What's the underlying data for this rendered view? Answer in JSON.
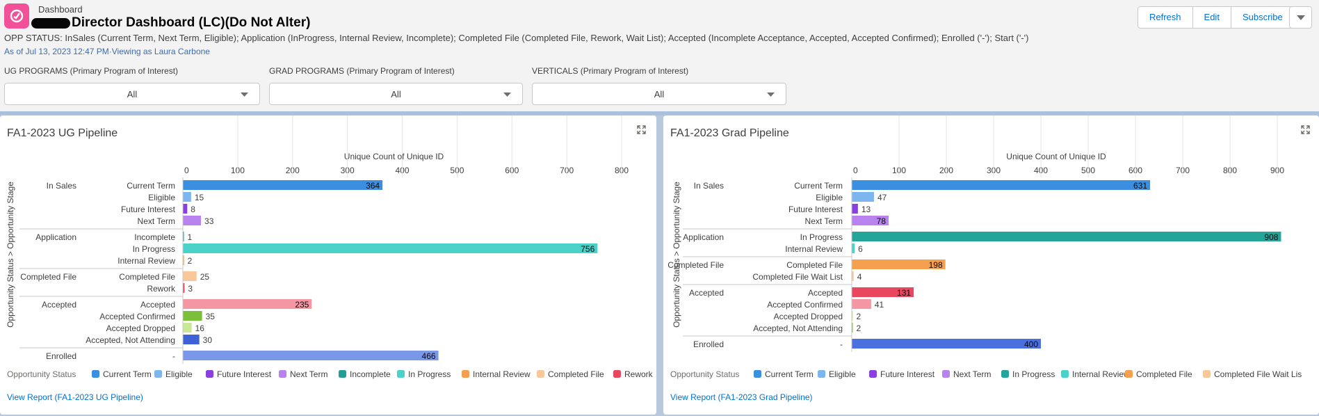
{
  "header": {
    "breadcrumb": "Dashboard",
    "title": "Director Dashboard (LC)(Do Not Alter)",
    "status_line": "OPP STATUS: InSales (Current Term, Next Term, Eligible); Application (InProgress, Internal Review, Incomplete); Completed File (Completed File, Rework, Wait List); Accepted (Incomplete Acceptance, Accepted, Accepted Confirmed); Enrolled ('-'); Start ('-')",
    "as_of": "As of Jul 13, 2023 12:47 PM·Viewing as Laura Carbone",
    "buttons": {
      "refresh": "Refresh",
      "edit": "Edit",
      "subscribe": "Subscribe"
    },
    "app_icon": "dashboard-app-icon",
    "menu_icon": "chevron-down-icon"
  },
  "filters": [
    {
      "label": "UG PROGRAMS (Primary Program of Interest)",
      "value": "All"
    },
    {
      "label": "GRAD PROGRAMS (Primary Program of Interest)",
      "value": "All"
    },
    {
      "label": "VERTICALS (Primary Program of Interest)",
      "value": "All"
    }
  ],
  "colors": {
    "Current Term": "#3b8fe0",
    "Eligible": "#7db6ef",
    "Future Interest": "#8a3fe0",
    "Next Term": "#b983ef",
    "Incomplete": "#239e94",
    "In Progress": "#4ad1c8",
    "Internal Review": "#f5a04e",
    "Completed File": "#f8c89a",
    "Rework": "#e8475f",
    "Accepted": "#f497a3",
    "Accepted Confirmed": "#7bbf3b",
    "Accepted Dropped": "#c9e895",
    "Accepted, Not Attending": "#3f61d6",
    "Enrolled -": "#7b97e8",
    "grad_In Progress": "#23a59a",
    "grad_Internal Review": "#4ad1c8",
    "grad_Completed File": "#f5a04e",
    "grad_Completed File Wait List": "#f8c89a",
    "grad_Accepted": "#e8475f",
    "grad_Accepted Confirmed": "#f497a3",
    "grad_Accepted Dropped": "#c9e895",
    "grad_Accepted, Not Attending": "#7bbf3b",
    "grad_Enrolled -": "#4a6fde"
  },
  "chart_data": [
    {
      "type": "bar",
      "title": "FA1-2023 UG Pipeline",
      "xlabel": "Unique Count of Unique ID",
      "ylabel": "Opportunity Status > Opportunity Stage",
      "xlim": [
        0,
        800
      ],
      "ticks": [
        "0",
        "100",
        "200",
        "300",
        "400",
        "500",
        "600",
        "700",
        "800"
      ],
      "groups": [
        {
          "stage": "In Sales",
          "rows": [
            {
              "status": "Current Term",
              "value": 364
            },
            {
              "status": "Eligible",
              "value": 15
            },
            {
              "status": "Future Interest",
              "value": 8
            },
            {
              "status": "Next Term",
              "value": 33
            }
          ]
        },
        {
          "stage": "Application",
          "rows": [
            {
              "status": "Incomplete",
              "value": 1
            },
            {
              "status": "In Progress",
              "value": 756
            },
            {
              "status": "Internal Review",
              "value": 2
            }
          ]
        },
        {
          "stage": "Completed File",
          "rows": [
            {
              "status": "Completed File",
              "value": 25
            },
            {
              "status": "Rework",
              "value": 3
            }
          ]
        },
        {
          "stage": "Accepted",
          "rows": [
            {
              "status": "Accepted",
              "value": 235
            },
            {
              "status": "Accepted Confirmed",
              "value": 35
            },
            {
              "status": "Accepted Dropped",
              "value": 16
            },
            {
              "status": "Accepted, Not Attending",
              "value": 30
            }
          ]
        },
        {
          "stage": "Enrolled",
          "rows": [
            {
              "status": "-",
              "value": 466
            }
          ]
        }
      ],
      "legend_title": "Opportunity Status",
      "legend": [
        "Current Term",
        "Eligible",
        "Future Interest",
        "Next Term",
        "Incomplete",
        "In Progress",
        "Internal Review",
        "Completed File",
        "Rework"
      ],
      "legend_colors": [
        "#3b8fe0",
        "#7db6ef",
        "#8a3fe0",
        "#b983ef",
        "#239e94",
        "#4ad1c8",
        "#f5a04e",
        "#f8c89a",
        "#e8475f"
      ],
      "view_report": "View Report (FA1-2023 UG Pipeline)"
    },
    {
      "type": "bar",
      "title": "FA1-2023 Grad Pipeline",
      "xlabel": "Unique Count of Unique ID",
      "ylabel": "Opportunity Status > Opportunity Stage",
      "xlim": [
        0,
        900
      ],
      "ticks": [
        "0",
        "100",
        "200",
        "300",
        "400",
        "500",
        "600",
        "700",
        "800",
        "900"
      ],
      "groups": [
        {
          "stage": "In Sales",
          "rows": [
            {
              "status": "Current Term",
              "value": 631
            },
            {
              "status": "Eligible",
              "value": 47
            },
            {
              "status": "Future Interest",
              "value": 13
            },
            {
              "status": "Next Term",
              "value": 78
            }
          ]
        },
        {
          "stage": "Application",
          "rows": [
            {
              "status": "In Progress",
              "value": 908
            },
            {
              "status": "Internal Review",
              "value": 6
            }
          ]
        },
        {
          "stage": "Completed File",
          "rows": [
            {
              "status": "Completed File",
              "value": 198
            },
            {
              "status": "Completed File Wait List",
              "value": 4
            }
          ]
        },
        {
          "stage": "Accepted",
          "rows": [
            {
              "status": "Accepted",
              "value": 131
            },
            {
              "status": "Accepted Confirmed",
              "value": 41
            },
            {
              "status": "Accepted Dropped",
              "value": 2
            },
            {
              "status": "Accepted, Not Attending",
              "value": 2
            }
          ]
        },
        {
          "stage": "Enrolled",
          "rows": [
            {
              "status": "-",
              "value": 400
            }
          ]
        }
      ],
      "legend_title": "Opportunity Status",
      "legend": [
        "Current Term",
        "Eligible",
        "Future Interest",
        "Next Term",
        "In Progress",
        "Internal Review",
        "Completed File",
        "Completed File Wait Lis"
      ],
      "legend_colors": [
        "#3b8fe0",
        "#7db6ef",
        "#8a3fe0",
        "#b983ef",
        "#23a59a",
        "#4ad1c8",
        "#f5a04e",
        "#f8c89a"
      ],
      "view_report": "View Report (FA1-2023 Grad Pipeline)"
    }
  ]
}
